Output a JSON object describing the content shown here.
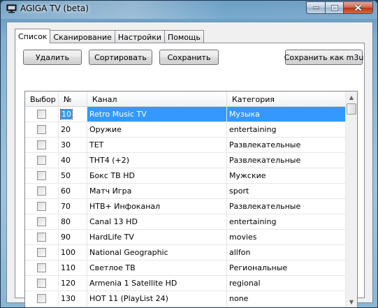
{
  "window": {
    "title": "AGIGA TV (beta)"
  },
  "tabs": [
    {
      "label": "Список"
    },
    {
      "label": "Сканирование"
    },
    {
      "label": "Настройки"
    },
    {
      "label": "Помощь"
    }
  ],
  "toolbar": {
    "delete_label": "Удалить",
    "sort_label": "Сортировать",
    "save_label": "Сохранить",
    "save_m3u_label": "Сохранить как m3u"
  },
  "table": {
    "headers": {
      "select": "Выбор",
      "number": "№",
      "channel": "Канал",
      "category": "Категория"
    },
    "rows": [
      {
        "number": "10",
        "channel": "Retro Music TV",
        "category": "Музыка",
        "selected": true
      },
      {
        "number": "20",
        "channel": "Оружие",
        "category": "entertaining"
      },
      {
        "number": "30",
        "channel": "ТЕТ",
        "category": "Развлекательные"
      },
      {
        "number": "40",
        "channel": "ТНТ4 (+2)",
        "category": "Развлекательные"
      },
      {
        "number": "50",
        "channel": "Бокс ТВ HD",
        "category": "Мужские"
      },
      {
        "number": "60",
        "channel": "Матч Игра",
        "category": "sport"
      },
      {
        "number": "70",
        "channel": "НТВ+ Инфоканал",
        "category": "Развлекательные"
      },
      {
        "number": "80",
        "channel": "Canal 13 HD",
        "category": "entertaining"
      },
      {
        "number": "90",
        "channel": "HardLife TV",
        "category": "movies"
      },
      {
        "number": "100",
        "channel": "National Geographic",
        "category": "allfon"
      },
      {
        "number": "110",
        "channel": "Светлое ТВ",
        "category": "Региональные"
      },
      {
        "number": "120",
        "channel": "Armenia 1 Satellite HD",
        "category": "regional"
      },
      {
        "number": "130",
        "channel": "HOT 11 (PlayList 24)",
        "category": "none"
      }
    ]
  },
  "colors": {
    "selection": "#3399ff",
    "close_button": "#c7452b"
  }
}
